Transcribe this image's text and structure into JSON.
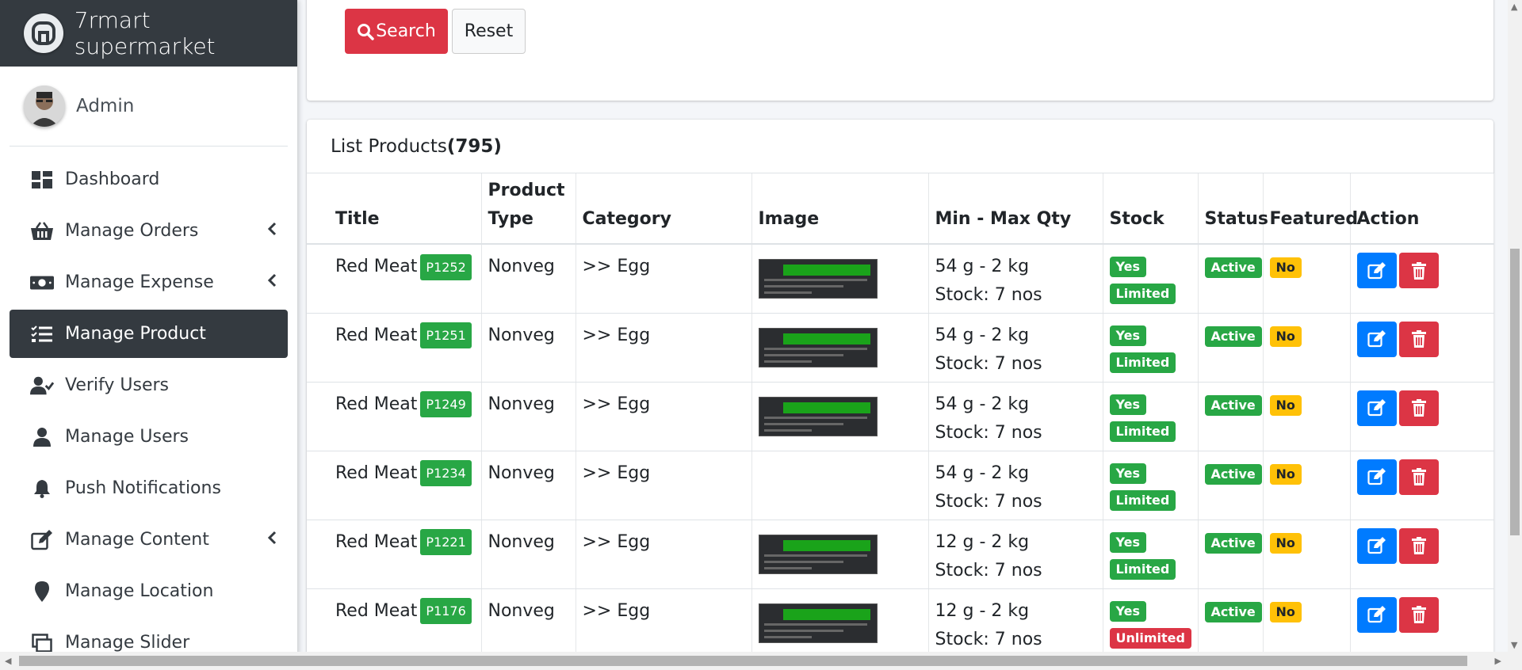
{
  "brand": {
    "name": "7rmart supermarket"
  },
  "user": {
    "name": "Admin"
  },
  "sidebar": {
    "items": [
      {
        "label": "Dashboard",
        "icon": "dashboard-icon",
        "chevron": false
      },
      {
        "label": "Manage Orders",
        "icon": "basket-icon",
        "chevron": true
      },
      {
        "label": "Manage Expense",
        "icon": "money-icon",
        "chevron": true
      },
      {
        "label": "Manage Product",
        "icon": "tasks-icon",
        "chevron": false,
        "active": true
      },
      {
        "label": "Verify Users",
        "icon": "user-check-icon",
        "chevron": false
      },
      {
        "label": "Manage Users",
        "icon": "user-icon",
        "chevron": false
      },
      {
        "label": "Push Notifications",
        "icon": "bell-icon",
        "chevron": false
      },
      {
        "label": "Manage Content",
        "icon": "edit-icon",
        "chevron": true
      },
      {
        "label": "Manage Location",
        "icon": "map-marker-icon",
        "chevron": false
      },
      {
        "label": "Manage Slider",
        "icon": "slider-icon",
        "chevron": false
      }
    ]
  },
  "search": {
    "search_label": "Search",
    "reset_label": "Reset"
  },
  "list": {
    "title": "List Products",
    "count": "(795)",
    "columns": [
      "Title",
      "Product Type",
      "Category",
      "Image",
      "Min - Max Qty",
      "Stock",
      "Status",
      "Featured",
      "Action"
    ],
    "rows": [
      {
        "title": "Red Meat",
        "code": "P1252",
        "type": "Nonveg",
        "category": ">> Egg",
        "has_image": true,
        "qty": "54 g - 2 kg",
        "stock": "Stock: 7 nos",
        "stock_yes": "Yes",
        "limit": "Limited",
        "limit_color": "green",
        "status": "Active",
        "featured": "No"
      },
      {
        "title": "Red Meat",
        "code": "P1251",
        "type": "Nonveg",
        "category": ">> Egg",
        "has_image": true,
        "qty": "54 g - 2 kg",
        "stock": "Stock: 7 nos",
        "stock_yes": "Yes",
        "limit": "Limited",
        "limit_color": "green",
        "status": "Active",
        "featured": "No"
      },
      {
        "title": "Red Meat",
        "code": "P1249",
        "type": "Nonveg",
        "category": ">> Egg",
        "has_image": true,
        "qty": "54 g - 2 kg",
        "stock": "Stock: 7 nos",
        "stock_yes": "Yes",
        "limit": "Limited",
        "limit_color": "green",
        "status": "Active",
        "featured": "No"
      },
      {
        "title": "Red Meat",
        "code": "P1234",
        "type": "Nonveg",
        "category": ">> Egg",
        "has_image": false,
        "qty": "54 g - 2 kg",
        "stock": "Stock: 7 nos",
        "stock_yes": "Yes",
        "limit": "Limited",
        "limit_color": "green",
        "status": "Active",
        "featured": "No"
      },
      {
        "title": "Red Meat",
        "code": "P1221",
        "type": "Nonveg",
        "category": ">> Egg",
        "has_image": true,
        "qty": "12 g - 2 kg",
        "stock": "Stock: 7 nos",
        "stock_yes": "Yes",
        "limit": "Limited",
        "limit_color": "green",
        "status": "Active",
        "featured": "No"
      },
      {
        "title": "Red Meat",
        "code": "P1176",
        "type": "Nonveg",
        "category": ">> Egg",
        "has_image": true,
        "qty": "12 g - 2 kg",
        "stock": "Stock: 7 nos",
        "stock_yes": "Yes",
        "limit": "Unlimited",
        "limit_color": "red",
        "status": "Active",
        "featured": "No"
      }
    ]
  },
  "colors": {
    "sidebar_active": "#343a40",
    "danger": "#dc3545",
    "success": "#28a745",
    "primary": "#007bff",
    "warning": "#ffc107"
  }
}
